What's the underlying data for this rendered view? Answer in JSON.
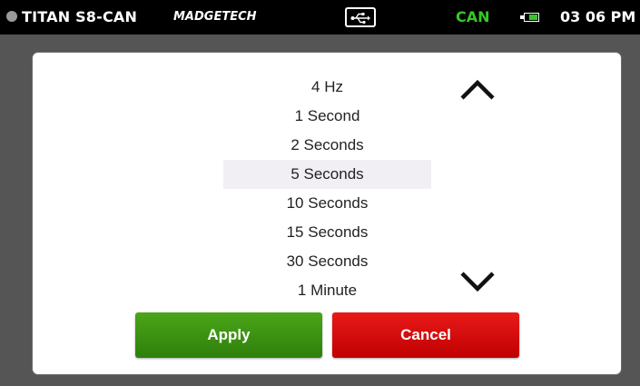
{
  "status_bar": {
    "device_name": "TITAN S8-CAN",
    "brand": "MADGETECH",
    "usb_icon": "usb-icon",
    "connection": "CAN",
    "battery_level": 0.7,
    "time": "03 06 PM",
    "colors": {
      "connection": "#34c924",
      "battery": "#34c924"
    }
  },
  "dialog": {
    "options": [
      {
        "label": "4 Hz",
        "selected": false
      },
      {
        "label": "1 Second",
        "selected": false
      },
      {
        "label": "2 Seconds",
        "selected": false
      },
      {
        "label": "5 Seconds",
        "selected": true
      },
      {
        "label": "10 Seconds",
        "selected": false
      },
      {
        "label": "15 Seconds",
        "selected": false
      },
      {
        "label": "30 Seconds",
        "selected": false
      },
      {
        "label": "1 Minute",
        "selected": false
      }
    ],
    "scroll_up_icon": "chevron-up-icon",
    "scroll_down_icon": "chevron-down-icon",
    "apply_label": "Apply",
    "cancel_label": "Cancel",
    "colors": {
      "apply": "#3a9012",
      "cancel": "#d90d0d",
      "selected_row": "#f2eff4"
    }
  }
}
